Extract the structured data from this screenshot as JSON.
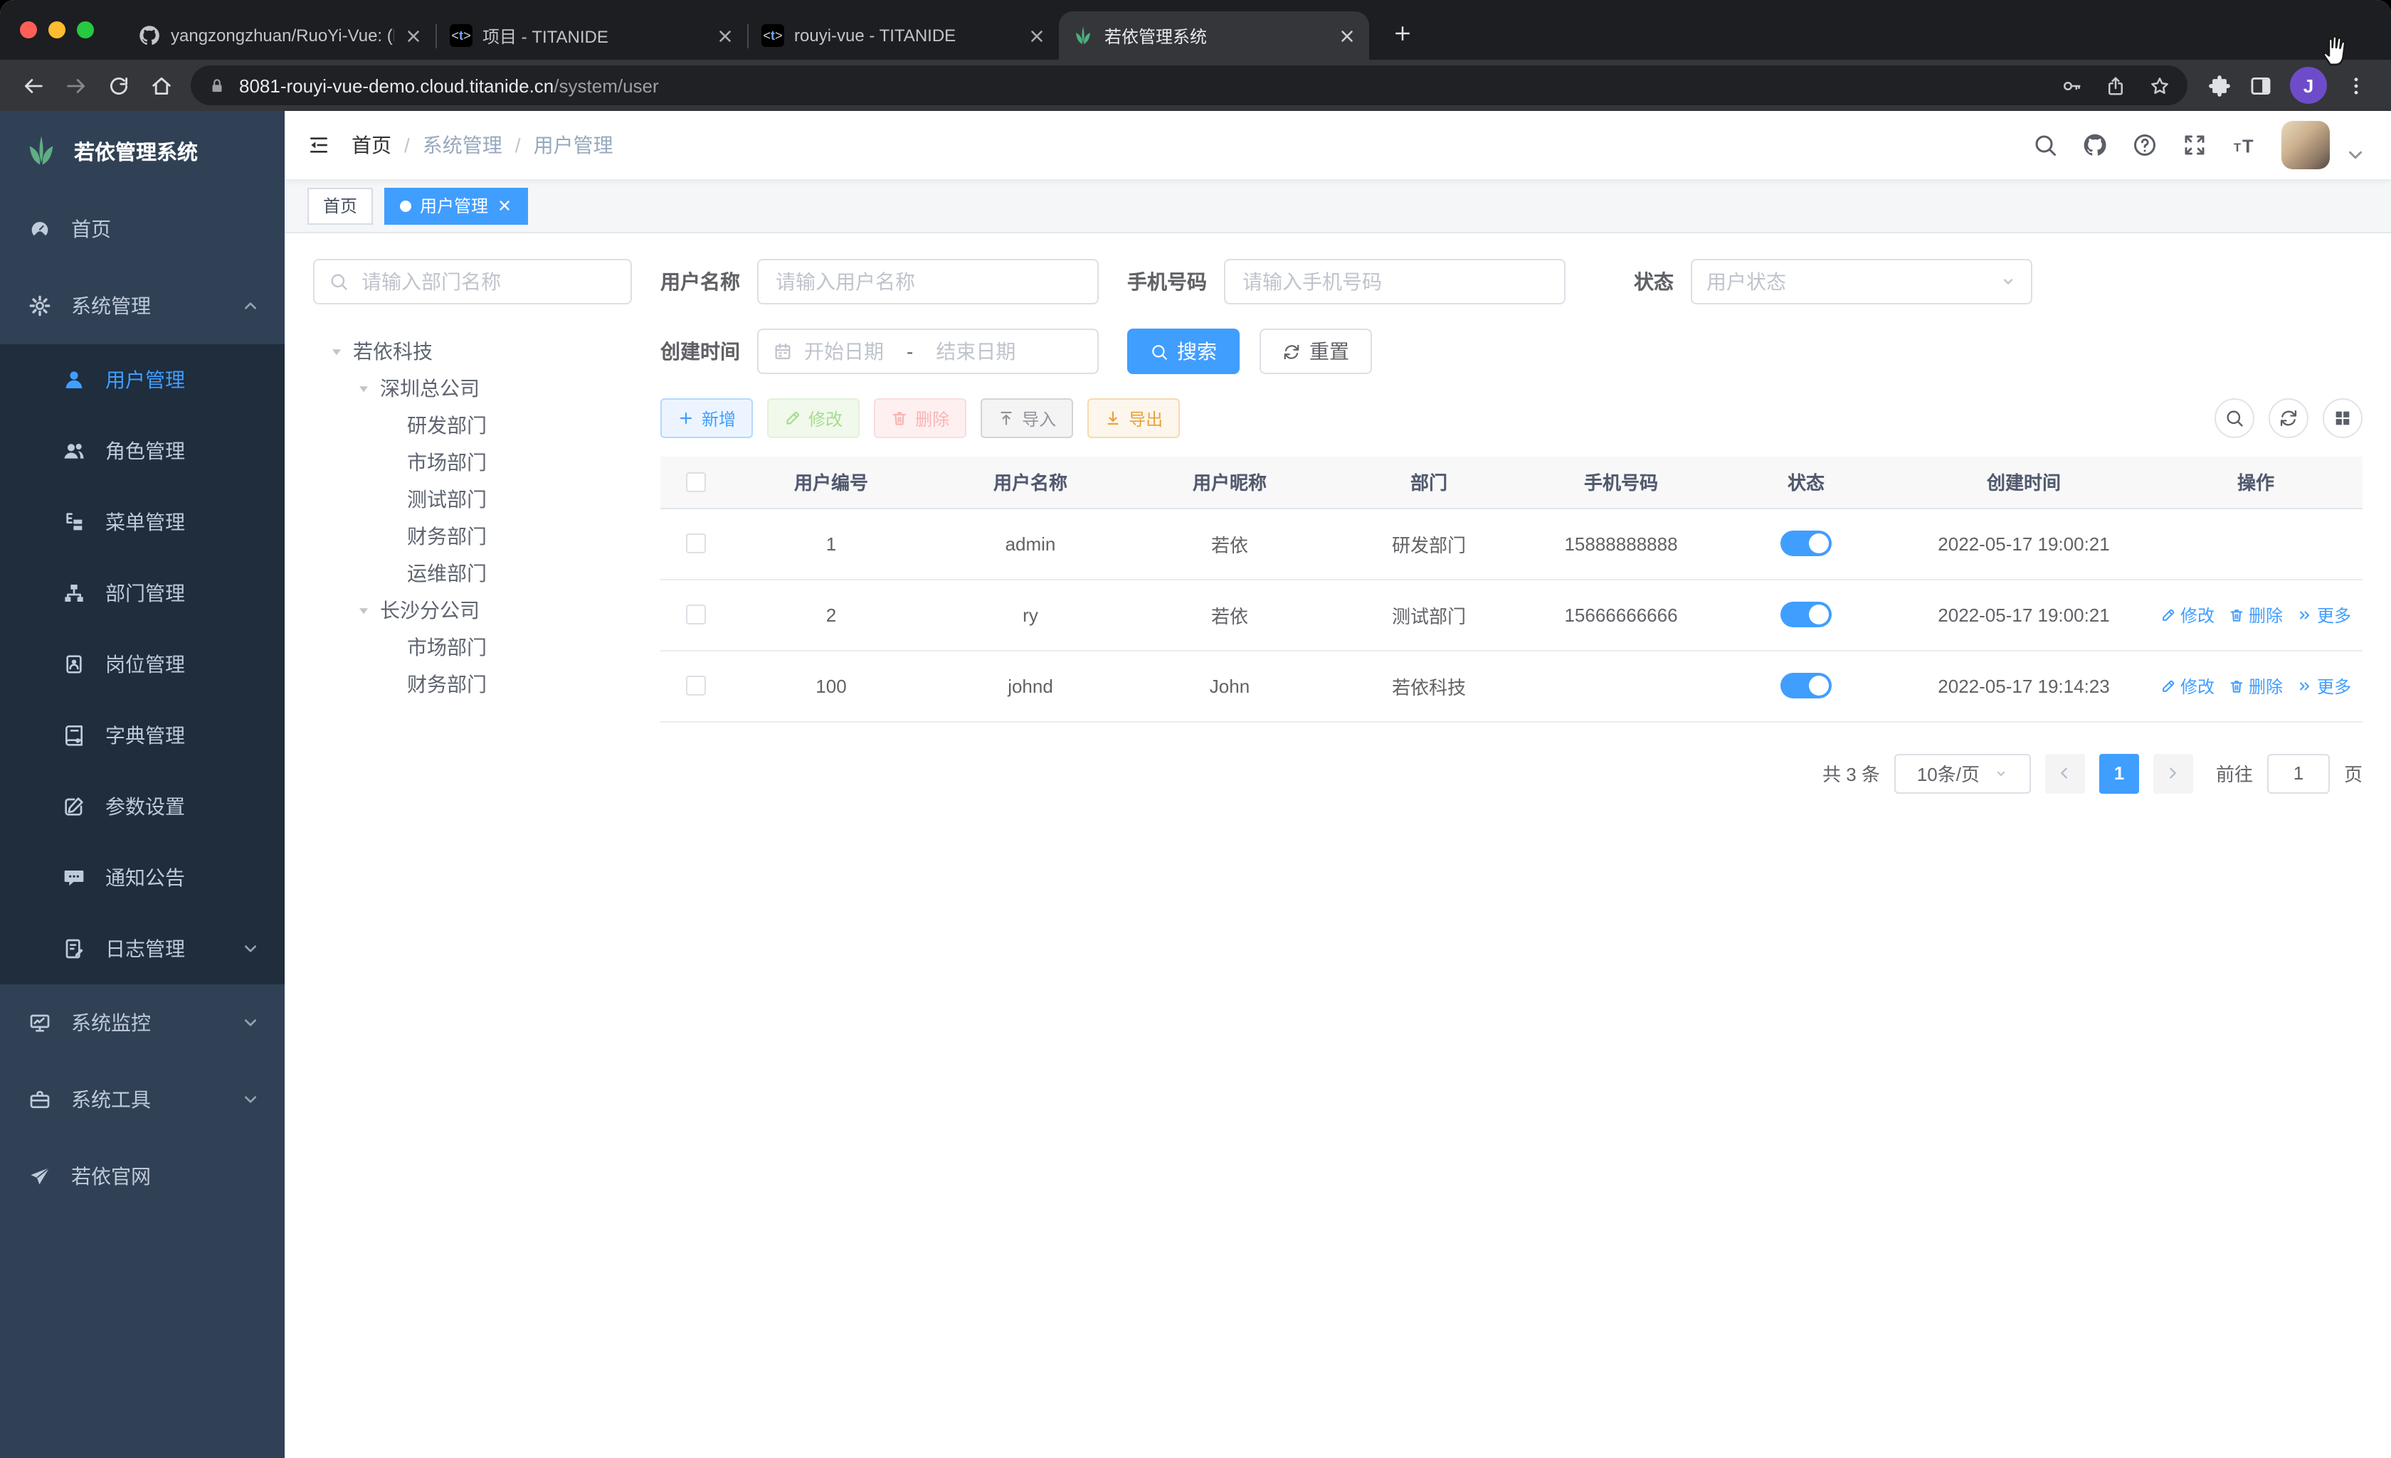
{
  "browser": {
    "tabs": [
      {
        "title": "yangzongzhuan/RuoYi-Vue: (R...",
        "icon": "github",
        "active": false
      },
      {
        "title": "项目 - TITANIDE",
        "icon": "titanide",
        "active": false
      },
      {
        "title": "rouyi-vue - TITANIDE",
        "icon": "titanide",
        "active": false
      },
      {
        "title": "若依管理系统",
        "icon": "ruoyi",
        "active": true
      }
    ],
    "address": {
      "host": "8081-rouyi-vue-demo.cloud.titanide.cn",
      "path": "/system/user"
    },
    "profile_initial": "J"
  },
  "app": {
    "logo_title": "若依管理系统",
    "menu": [
      {
        "key": "home",
        "label": "首页",
        "icon": "dashboard",
        "level": "root",
        "active": false,
        "caret": ""
      },
      {
        "key": "system-management",
        "label": "系统管理",
        "icon": "gear",
        "level": "root",
        "active": false,
        "caret": "up"
      },
      {
        "key": "user-management",
        "label": "用户管理",
        "icon": "user",
        "level": "sub",
        "active": true,
        "caret": ""
      },
      {
        "key": "role-management",
        "label": "角色管理",
        "icon": "users",
        "level": "sub",
        "active": false,
        "caret": ""
      },
      {
        "key": "menu-management",
        "label": "菜单管理",
        "icon": "menu",
        "level": "sub",
        "active": false,
        "caret": ""
      },
      {
        "key": "dept-management",
        "label": "部门管理",
        "icon": "org",
        "level": "sub",
        "active": false,
        "caret": ""
      },
      {
        "key": "post-management",
        "label": "岗位管理",
        "icon": "badge",
        "level": "sub",
        "active": false,
        "caret": ""
      },
      {
        "key": "dict-management",
        "label": "字典管理",
        "icon": "dict",
        "level": "sub",
        "active": false,
        "caret": ""
      },
      {
        "key": "param-settings",
        "label": "参数设置",
        "icon": "editpen",
        "level": "sub",
        "active": false,
        "caret": ""
      },
      {
        "key": "notice",
        "label": "通知公告",
        "icon": "message",
        "level": "sub",
        "active": false,
        "caret": ""
      },
      {
        "key": "log-management",
        "label": "日志管理",
        "icon": "log",
        "level": "sub",
        "active": false,
        "caret": "down"
      },
      {
        "key": "system-monitor",
        "label": "系统监控",
        "icon": "monitor",
        "level": "root",
        "active": false,
        "caret": "down"
      },
      {
        "key": "system-tools",
        "label": "系统工具",
        "icon": "tool",
        "level": "root",
        "active": false,
        "caret": "down"
      },
      {
        "key": "ruoyi-website",
        "label": "若依官网",
        "icon": "guide",
        "level": "root",
        "active": false,
        "caret": ""
      }
    ],
    "breadcrumb": [
      "首页",
      "系统管理",
      "用户管理"
    ],
    "tags": [
      {
        "label": "首页",
        "active": false
      },
      {
        "label": "用户管理",
        "active": true
      }
    ],
    "dept_panel": {
      "search_placeholder": "请输入部门名称",
      "tree": [
        {
          "label": "若依科技",
          "level": 0,
          "expandable": true
        },
        {
          "label": "深圳总公司",
          "level": 1,
          "expandable": true
        },
        {
          "label": "研发部门",
          "level": 2,
          "expandable": false
        },
        {
          "label": "市场部门",
          "level": 2,
          "expandable": false
        },
        {
          "label": "测试部门",
          "level": 2,
          "expandable": false
        },
        {
          "label": "财务部门",
          "level": 2,
          "expandable": false
        },
        {
          "label": "运维部门",
          "level": 2,
          "expandable": false
        },
        {
          "label": "长沙分公司",
          "level": 1,
          "expandable": true
        },
        {
          "label": "市场部门",
          "level": 2,
          "expandable": false
        },
        {
          "label": "财务部门",
          "level": 2,
          "expandable": false
        }
      ]
    },
    "filters": {
      "username_label": "用户名称",
      "username_placeholder": "请输入用户名称",
      "phone_label": "手机号码",
      "phone_placeholder": "请输入手机号码",
      "status_label": "状态",
      "status_placeholder": "用户状态",
      "date_label": "创建时间",
      "date_start": "开始日期",
      "date_separator": "-",
      "date_end": "结束日期",
      "search_button": "搜索",
      "reset_button": "重置"
    },
    "actions_toolbar": {
      "add": "新增",
      "edit": "修改",
      "delete": "删除",
      "import": "导入",
      "export": "导出"
    },
    "table": {
      "headers": [
        "用户编号",
        "用户名称",
        "用户昵称",
        "部门",
        "手机号码",
        "状态",
        "创建时间",
        "操作"
      ],
      "rows": [
        {
          "id": "1",
          "username": "admin",
          "nickname": "若依",
          "dept": "研发部门",
          "phone": "15888888888",
          "status": "on",
          "created": "2022-05-17 19:00:21",
          "has_actions": false
        },
        {
          "id": "2",
          "username": "ry",
          "nickname": "若依",
          "dept": "测试部门",
          "phone": "15666666666",
          "status": "on",
          "created": "2022-05-17 19:00:21",
          "has_actions": true
        },
        {
          "id": "100",
          "username": "johnd",
          "nickname": "John",
          "dept": "若依科技",
          "phone": "",
          "status": "on",
          "created": "2022-05-17 19:14:23",
          "has_actions": true
        }
      ]
    },
    "row_actions": {
      "edit": "修改",
      "delete": "删除",
      "more": "更多"
    },
    "pagination": {
      "total": "共 3 条",
      "page_size": "10条/页",
      "current_page": "1",
      "goto_label": "前往",
      "goto_value": "1",
      "goto_suffix": "页"
    }
  },
  "colors": {
    "primary": "#409eff",
    "success": "#67c23a",
    "warning": "#e6a23c",
    "danger": "#f56c6c",
    "info": "#909399",
    "sidebar_bg": "#304156",
    "sidebar_submenu_bg": "#1f2d3d",
    "sidebar_text": "#bfcbd9",
    "logo_green": "#5fae85",
    "tag_active_bg": "#409eff",
    "toggle_on": "#409eff",
    "chrome_profile": "#6e4cc9"
  }
}
